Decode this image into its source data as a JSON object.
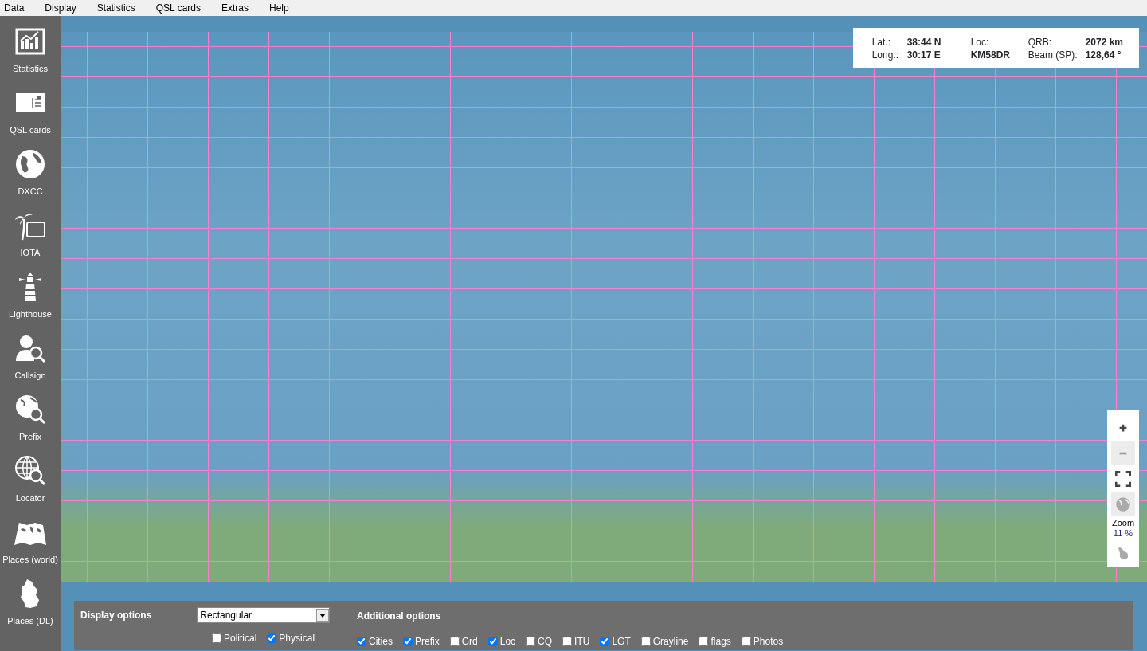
{
  "menu": [
    "Data",
    "Display",
    "Statistics",
    "QSL cards",
    "Extras",
    "Help"
  ],
  "sidebar": [
    {
      "kind": "chart",
      "label": "Statistics"
    },
    {
      "kind": "card",
      "label": "QSL cards"
    },
    {
      "kind": "globe",
      "label": "DXCC"
    },
    {
      "kind": "palm",
      "label": "IOTA"
    },
    {
      "kind": "lighthouse",
      "label": "Lighthouse"
    },
    {
      "kind": "person",
      "label": "Callsign"
    },
    {
      "kind": "globesearch",
      "label": "Prefix"
    },
    {
      "kind": "gridsearch",
      "label": "Locator"
    },
    {
      "kind": "worldmap",
      "label": "Places (world)"
    },
    {
      "kind": "country",
      "label": "Places (DL)"
    }
  ],
  "info": {
    "lat_label": "Lat.:",
    "lat": "38:44 N",
    "long_label": "Long.:",
    "long": "30:17 E",
    "loc_label": "Loc:",
    "loc": "KM58DR",
    "qrb_label": "QRB:",
    "qrb": "2072 km",
    "beam_label": "Beam (SP):",
    "beam": "128,64 °"
  },
  "zoom_controls": [
    {
      "kind": "plus",
      "disabled": false
    },
    {
      "kind": "minus",
      "disabled": true
    },
    {
      "kind": "fit",
      "disabled": false
    },
    {
      "kind": "globe",
      "disabled": true
    }
  ],
  "zoom": {
    "label": "Zoom",
    "value": "11 %"
  },
  "display_options": {
    "title": "Display options",
    "projection": "Rectangular",
    "checks": [
      {
        "label": "Political",
        "checked": false
      },
      {
        "label": "Physical",
        "checked": true
      }
    ]
  },
  "additional_options": {
    "title": "Additional options",
    "checks": [
      {
        "label": "Cities",
        "checked": true
      },
      {
        "label": "Prefix",
        "checked": true
      },
      {
        "label": "Grd",
        "checked": false
      },
      {
        "label": "Loc",
        "checked": true
      },
      {
        "label": "CQ",
        "checked": false
      },
      {
        "label": "ITU",
        "checked": false
      },
      {
        "label": "LGT",
        "checked": true
      },
      {
        "label": "Grayline",
        "checked": false
      },
      {
        "label": "flags",
        "checked": false
      },
      {
        "label": "Photos",
        "checked": false
      }
    ]
  }
}
